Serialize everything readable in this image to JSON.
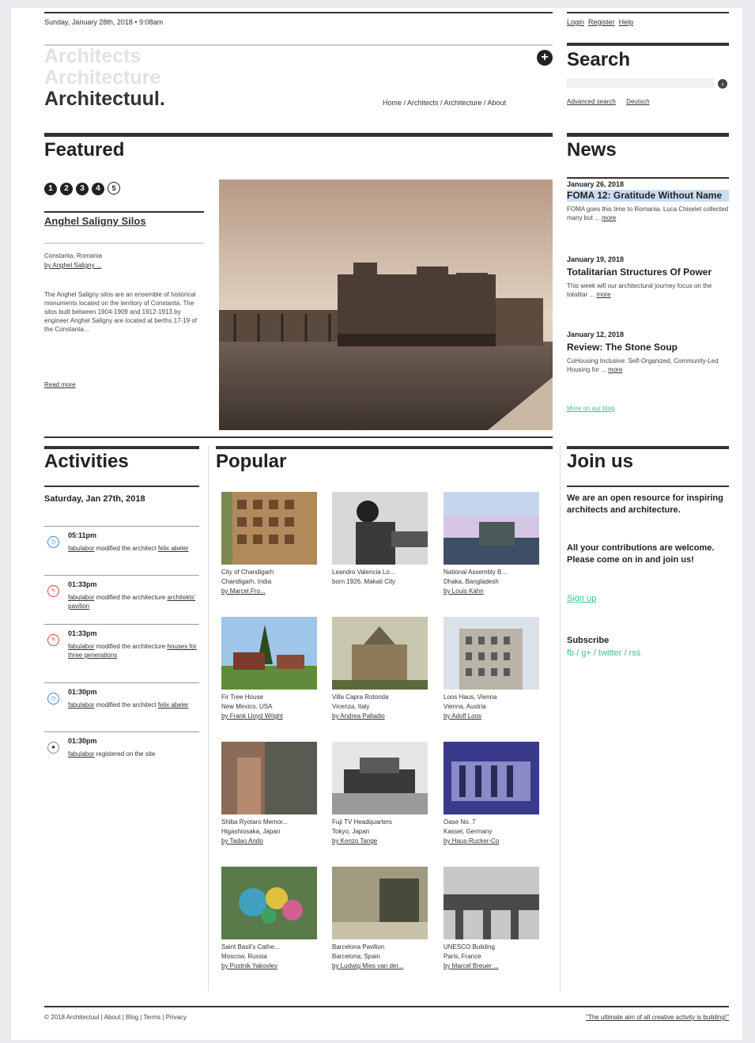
{
  "header": {
    "date": "Sunday, January 28th, 2018 • 9:08am",
    "account_links": [
      "Login",
      "Register",
      "Help"
    ],
    "logo_lines": [
      "Architects",
      "Architecture",
      "Architectuul."
    ],
    "breadcrumb": "Home / Architects / Architecture / About"
  },
  "search": {
    "title": "Search",
    "placeholder": "",
    "advanced": "Advanced search",
    "lang": "Deutsch"
  },
  "featured": {
    "title": "Featured",
    "slides": [
      "1",
      "2",
      "3",
      "4",
      "5"
    ],
    "name": "Anghel Saligny Silos",
    "location": "Constanta, Romania",
    "by": "by Anghel Saligny ...",
    "description": "The Anghel Saligny silos are an ensemble of historical monuments located on the territory of Constanta. The silos built between 1904-1909 and 1912-1913 by engineer Anghel Saligny are located at berths 17-19 of the Constanta...",
    "read_more": "Read more"
  },
  "news": {
    "title": "News",
    "items": [
      {
        "date": "January 26, 2018",
        "title": "FOMA 12: Gratitude Without Name",
        "text": "FOMA goes this time to Romania. Luca Chiselet collected many but ...",
        "more": "more"
      },
      {
        "date": "January 19, 2018",
        "title": "Totalitarian Structures Of Power",
        "text": "This week will our architectural journey focus on the totalitar ...",
        "more": "more"
      },
      {
        "date": "January 12, 2018",
        "title": "Review: The Stone Soup",
        "text": "CoHousing Inclusive: Self-Organized, Community-Led Housing for ...",
        "more": "more"
      }
    ],
    "blog_link": "More on our blog"
  },
  "activities": {
    "title": "Activities",
    "date": "Saturday, Jan 27th, 2018",
    "items": [
      {
        "time": "05:11pm",
        "user": "fabulabor",
        "action": "modified the architect",
        "target": "felix abeler",
        "icon": "clock-icon"
      },
      {
        "time": "01:33pm",
        "user": "fabulabor",
        "action": "modified the architecture",
        "target": "architekts' pavilion",
        "icon": "pencil-icon"
      },
      {
        "time": "01:33pm",
        "user": "fabulabor",
        "action": "modified the architecture",
        "target": "houses for three generations",
        "icon": "pencil-icon"
      },
      {
        "time": "01:30pm",
        "user": "fabulabor",
        "action": "modified the architect",
        "target": "felix abeler",
        "icon": "clock-icon"
      },
      {
        "time": "01:30pm",
        "user": "fabulabor",
        "action": "registered on the site",
        "target": "",
        "icon": "star-icon"
      }
    ]
  },
  "popular": {
    "title": "Popular",
    "items": [
      {
        "name": "City of Chandigarh",
        "place": "Chandigarh, India",
        "by": "by Marcel Fro..."
      },
      {
        "name": "Leandro Valencia Lo...",
        "place": "born 1926, Makati City",
        "by": ""
      },
      {
        "name": "National Assembly B...",
        "place": "Dhaka, Bangladesh",
        "by": "by Louis Kahn"
      },
      {
        "name": "Fir Tree House",
        "place": "New Mexico, USA",
        "by": "by Frank Lloyd Wright"
      },
      {
        "name": "Villa Capra Rotonda",
        "place": "Vicenza, Italy",
        "by": "by Andrea Palladio"
      },
      {
        "name": "Loos Haus, Vienna",
        "place": "Vienna, Austria",
        "by": "by Adolf Loos"
      },
      {
        "name": "Shiba Ryotaro Memor...",
        "place": "Higashiosaka, Japan",
        "by": "by Tadao Ando"
      },
      {
        "name": "Fuji TV Headquarters",
        "place": "Tokyo, Japan",
        "by": "by Kenzo Tange"
      },
      {
        "name": "Oase No. 7",
        "place": "Kassel, Germany",
        "by": "by Haus-Rucker-Co"
      },
      {
        "name": "Saint Basil's Cathe...",
        "place": "Moscow, Russia",
        "by": "by Postnik Yakovlev"
      },
      {
        "name": "Barcelona Pavilion",
        "place": "Barcelona, Spain",
        "by": "by Ludwig Mies van der..."
      },
      {
        "name": "UNESCO Building",
        "place": "Paris, France",
        "by": "by Marcel Breuer ..."
      }
    ]
  },
  "join": {
    "title": "Join us",
    "text1": "We are an open resource for inspiring architects and architecture.",
    "text2": "All your contributions are welcome. Please come on in and join us!",
    "signup": "Sign up",
    "subscribe_title": "Subscribe",
    "subscribe_links": "fb / g+ / twitter / rss"
  },
  "footer": {
    "left": "© 2018 Architectuul | About | Blog | Terms | Privacy",
    "right": "\"The ultimate aim of all creative activity is building!\""
  },
  "colors": {
    "accent": "#3fbf8e",
    "rules": "#333333",
    "highlight": "#c9ddf3"
  }
}
